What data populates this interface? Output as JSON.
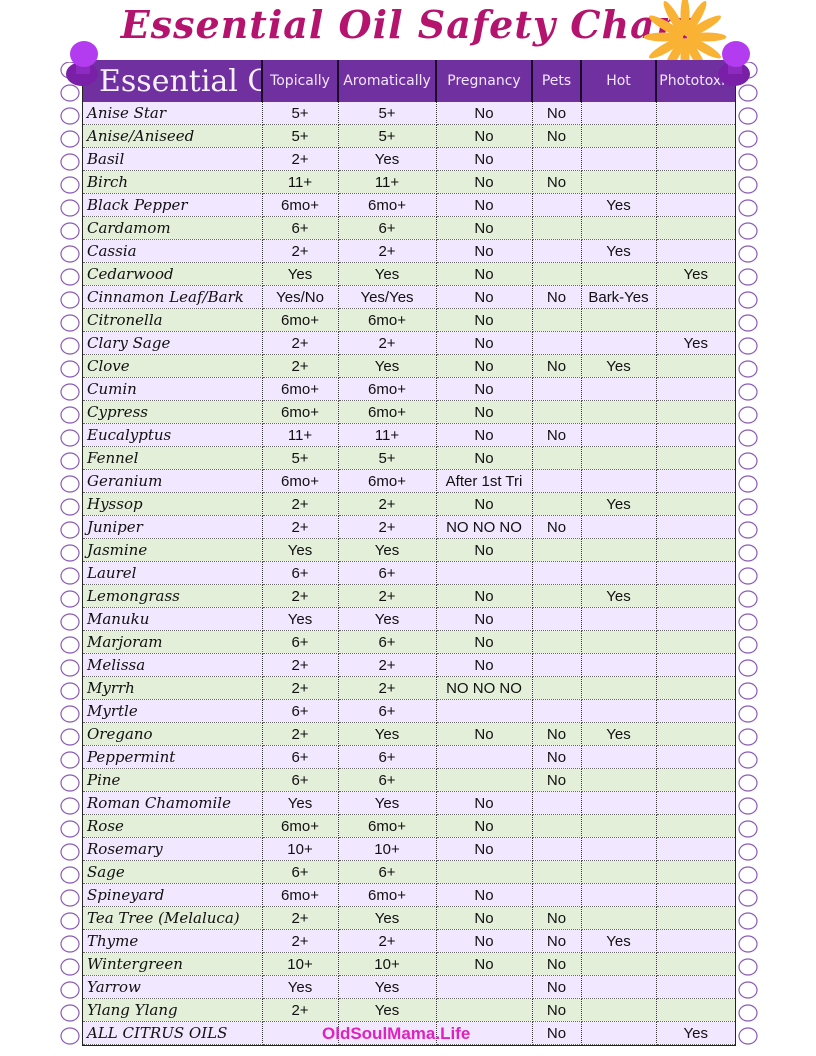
{
  "title": "Essential Oil Safety Chart",
  "watermark": "OldSoulMama.Life",
  "colors": {
    "title": "#b5146e",
    "header_bg": "#7030a0",
    "row_odd": "#f1e7ff",
    "row_even": "#e3efd9",
    "flower": "#f9b234",
    "pin": "#b026ff",
    "watermark": "#e020c0"
  },
  "headers": [
    "Essential Oil",
    "Topically",
    "Aromatically",
    "Pregnancy",
    "Pets",
    "Hot",
    "Phototoxic"
  ],
  "rows": [
    [
      "Anise Star",
      "5+",
      "5+",
      "No",
      "No",
      "",
      ""
    ],
    [
      "Anise/Aniseed",
      "5+",
      "5+",
      "No",
      "No",
      "",
      ""
    ],
    [
      "Basil",
      "2+",
      "Yes",
      "No",
      "",
      "",
      ""
    ],
    [
      "Birch",
      "11+",
      "11+",
      "No",
      "No",
      "",
      ""
    ],
    [
      "Black Pepper",
      "6mo+",
      "6mo+",
      "No",
      "",
      "Yes",
      ""
    ],
    [
      "Cardamom",
      "6+",
      "6+",
      "No",
      "",
      "",
      ""
    ],
    [
      "Cassia",
      "2+",
      "2+",
      "No",
      "",
      "Yes",
      ""
    ],
    [
      "Cedarwood",
      "Yes",
      "Yes",
      "No",
      "",
      "",
      "Yes"
    ],
    [
      "Cinnamon Leaf/Bark",
      "Yes/No",
      "Yes/Yes",
      "No",
      "No",
      "Bark-Yes",
      ""
    ],
    [
      "Citronella",
      "6mo+",
      "6mo+",
      "No",
      "",
      "",
      ""
    ],
    [
      "Clary Sage",
      "2+",
      "2+",
      "No",
      "",
      "",
      "Yes"
    ],
    [
      "Clove",
      "2+",
      "Yes",
      "No",
      "No",
      "Yes",
      ""
    ],
    [
      "Cumin",
      "6mo+",
      "6mo+",
      "No",
      "",
      "",
      ""
    ],
    [
      "Cypress",
      "6mo+",
      "6mo+",
      "No",
      "",
      "",
      ""
    ],
    [
      "Eucalyptus",
      "11+",
      "11+",
      "No",
      "No",
      "",
      ""
    ],
    [
      "Fennel",
      "5+",
      "5+",
      "No",
      "",
      "",
      ""
    ],
    [
      "Geranium",
      "6mo+",
      "6mo+",
      "After 1st Tri",
      "",
      "",
      ""
    ],
    [
      "Hyssop",
      "2+",
      "2+",
      "No",
      "",
      "Yes",
      ""
    ],
    [
      "Juniper",
      "2+",
      "2+",
      "NO NO NO",
      "No",
      "",
      ""
    ],
    [
      "Jasmine",
      "Yes",
      "Yes",
      "No",
      "",
      "",
      ""
    ],
    [
      "Laurel",
      "6+",
      "6+",
      "",
      "",
      "",
      ""
    ],
    [
      "Lemongrass",
      "2+",
      "2+",
      "No",
      "",
      "Yes",
      ""
    ],
    [
      "Manuku",
      "Yes",
      "Yes",
      "No",
      "",
      "",
      ""
    ],
    [
      "Marjoram",
      "6+",
      "6+",
      "No",
      "",
      "",
      ""
    ],
    [
      "Melissa",
      "2+",
      "2+",
      "No",
      "",
      "",
      ""
    ],
    [
      "Myrrh",
      "2+",
      "2+",
      "NO NO NO",
      "",
      "",
      ""
    ],
    [
      "Myrtle",
      "6+",
      "6+",
      "",
      "",
      "",
      ""
    ],
    [
      "Oregano",
      "2+",
      "Yes",
      "No",
      "No",
      "Yes",
      ""
    ],
    [
      "Peppermint",
      "6+",
      "6+",
      "",
      "No",
      "",
      ""
    ],
    [
      "Pine",
      "6+",
      "6+",
      "",
      "No",
      "",
      ""
    ],
    [
      "Roman Chamomile",
      "Yes",
      "Yes",
      "No",
      "",
      "",
      ""
    ],
    [
      "Rose",
      "6mo+",
      "6mo+",
      "No",
      "",
      "",
      ""
    ],
    [
      "Rosemary",
      "10+",
      "10+",
      "No",
      "",
      "",
      ""
    ],
    [
      "Sage",
      "6+",
      "6+",
      "",
      "",
      "",
      ""
    ],
    [
      "Spineyard",
      "6mo+",
      "6mo+",
      "No",
      "",
      "",
      ""
    ],
    [
      "Tea Tree (Melaluca)",
      "2+",
      "Yes",
      "No",
      "No",
      "",
      ""
    ],
    [
      "Thyme",
      "2+",
      "2+",
      "No",
      "No",
      "Yes",
      ""
    ],
    [
      "Wintergreen",
      "10+",
      "10+",
      "No",
      "No",
      "",
      ""
    ],
    [
      "Yarrow",
      "Yes",
      "Yes",
      "",
      "No",
      "",
      ""
    ],
    [
      "Ylang Ylang",
      "2+",
      "Yes",
      "",
      "No",
      "",
      ""
    ],
    [
      "ALL CITRUS OILS",
      "",
      "",
      "",
      "No",
      "",
      "Yes"
    ]
  ]
}
